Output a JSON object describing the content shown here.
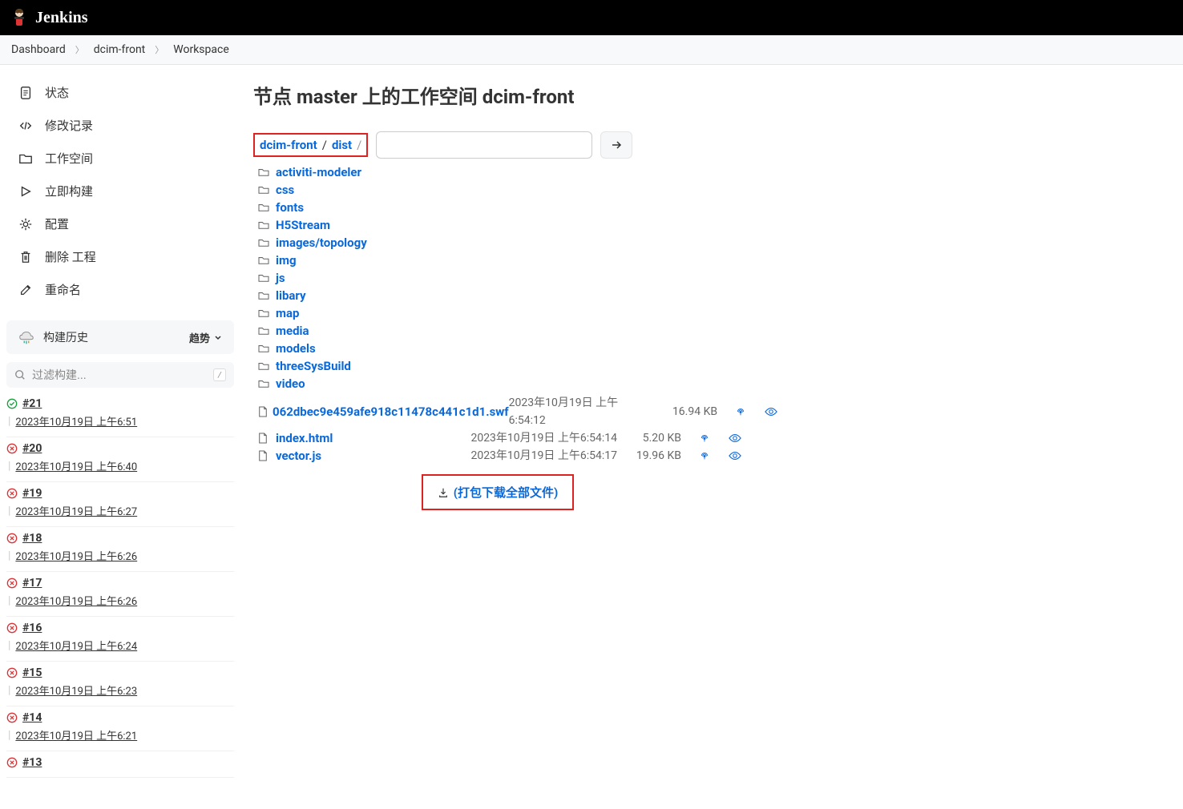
{
  "header": {
    "title": "Jenkins"
  },
  "breadcrumb": [
    {
      "label": "Dashboard"
    },
    {
      "label": "dcim-front"
    },
    {
      "label": "Workspace"
    }
  ],
  "sidebar": {
    "nav": [
      {
        "icon": "file",
        "label": "状态"
      },
      {
        "icon": "code",
        "label": "修改记录"
      },
      {
        "icon": "folder",
        "label": "工作空间"
      },
      {
        "icon": "play",
        "label": "立即构建"
      },
      {
        "icon": "gear",
        "label": "配置"
      },
      {
        "icon": "trash",
        "label": "删除 工程"
      },
      {
        "icon": "edit",
        "label": "重命名"
      }
    ],
    "buildHistory": {
      "title": "构建历史",
      "trendLabel": "趋势",
      "filterPlaceholder": "过滤构建...",
      "filterHint": "/",
      "items": [
        {
          "id": "#21",
          "status": "success",
          "date": "2023年10月19日 上午6:51"
        },
        {
          "id": "#20",
          "status": "fail",
          "date": "2023年10月19日 上午6:40"
        },
        {
          "id": "#19",
          "status": "fail",
          "date": "2023年10月19日 上午6:27"
        },
        {
          "id": "#18",
          "status": "fail",
          "date": "2023年10月19日 上午6:26"
        },
        {
          "id": "#17",
          "status": "fail",
          "date": "2023年10月19日 上午6:26"
        },
        {
          "id": "#16",
          "status": "fail",
          "date": "2023年10月19日 上午6:24"
        },
        {
          "id": "#15",
          "status": "fail",
          "date": "2023年10月19日 上午6:23"
        },
        {
          "id": "#14",
          "status": "fail",
          "date": "2023年10月19日 上午6:21"
        },
        {
          "id": "#13",
          "status": "fail",
          "date": ""
        }
      ]
    }
  },
  "main": {
    "title": "节点 master 上的工作空间 dcim-front",
    "path": {
      "root": "dcim-front",
      "sub": "dist"
    },
    "folders": [
      "activiti-modeler",
      "css",
      "fonts",
      "H5Stream",
      "images/topology",
      "img",
      "js",
      "libary",
      "map",
      "media",
      "models",
      "threeSysBuild",
      "video"
    ],
    "files": [
      {
        "name": "062dbec9e459afe918c11478c441c1d1.swf",
        "date": "2023年10月19日 上午6:54:12",
        "size": "16.94 KB"
      },
      {
        "name": "index.html",
        "date": "2023年10月19日 上午6:54:14",
        "size": "5.20 KB"
      },
      {
        "name": "vector.js",
        "date": "2023年10月19日 上午6:54:17",
        "size": "19.96 KB"
      }
    ],
    "downloadAll": "(打包下载全部文件)"
  }
}
